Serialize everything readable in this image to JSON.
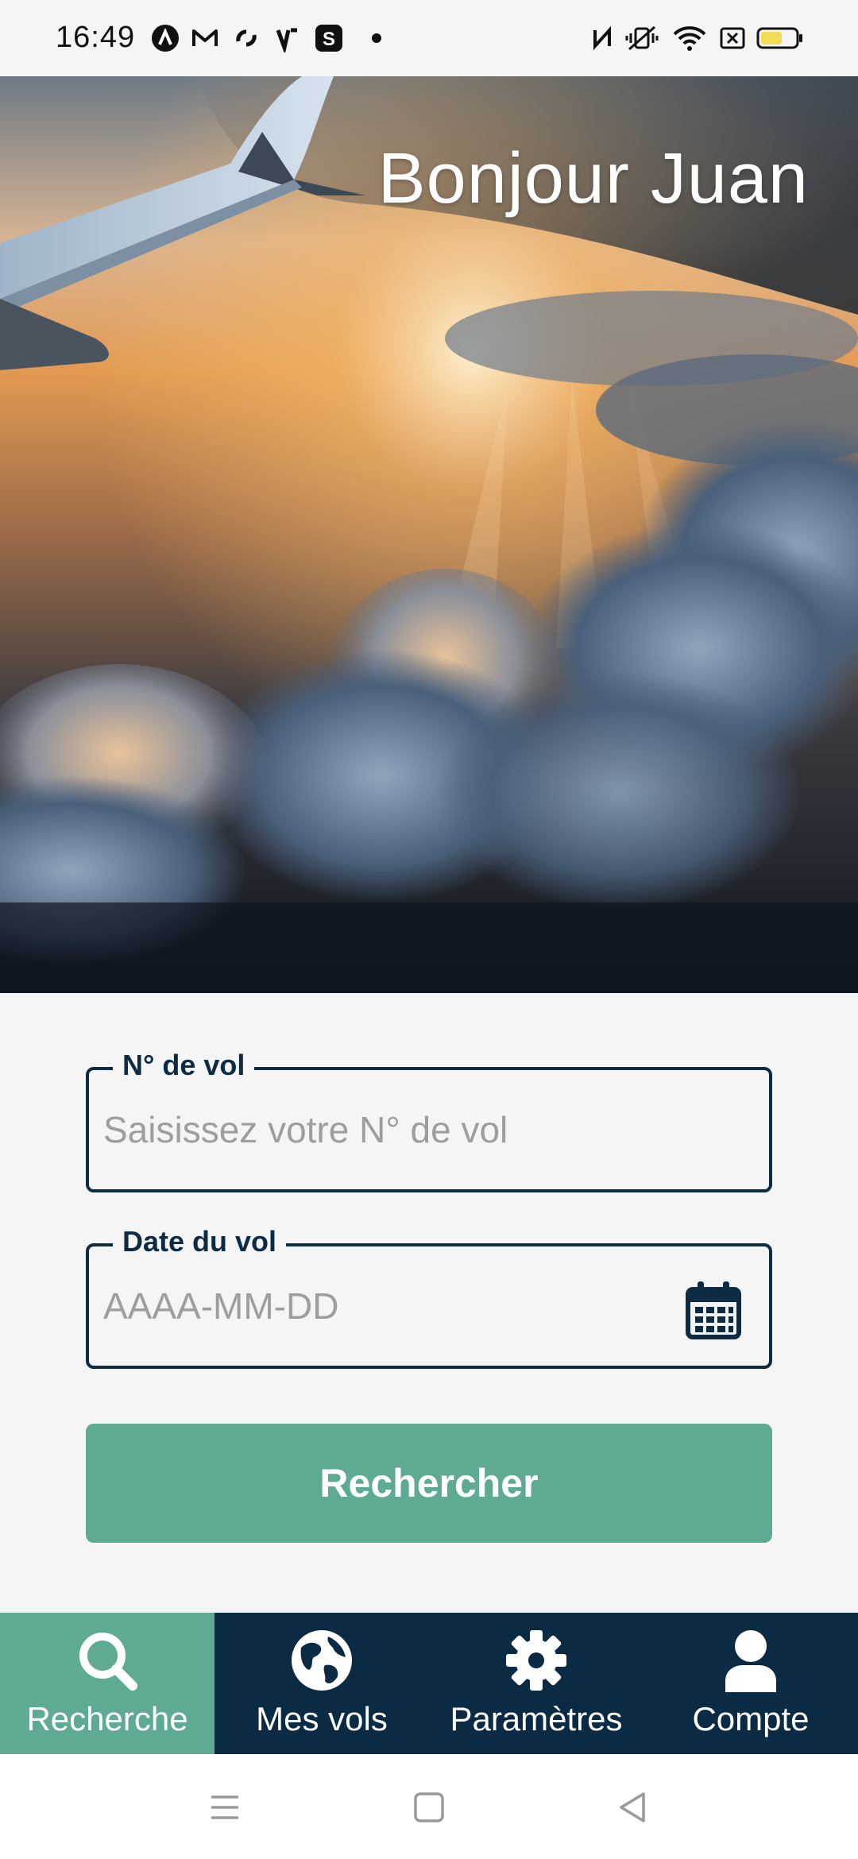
{
  "status_bar": {
    "time": "16:49",
    "left_icons": [
      "app-a-icon",
      "gmail-icon",
      "app-loop-icon",
      "app-v-icon",
      "app-s-icon",
      "dot-icon"
    ],
    "right_icons": [
      "nfc-icon",
      "vibrate-icon",
      "wifi-icon",
      "sim-icon",
      "battery-icon"
    ]
  },
  "hero": {
    "greeting": "Bonjour Juan"
  },
  "form": {
    "flight_number": {
      "label": "N° de vol",
      "placeholder": "Saisissez votre N° de vol",
      "value": ""
    },
    "flight_date": {
      "label": "Date du vol",
      "placeholder": "AAAA-MM-DD",
      "value": "",
      "icon": "calendar-icon"
    },
    "search_button": "Rechercher"
  },
  "bottom_nav": {
    "items": [
      {
        "label": "Recherche",
        "icon": "search-icon",
        "active": true
      },
      {
        "label": "Mes vols",
        "icon": "globe-icon",
        "active": false
      },
      {
        "label": "Paramètres",
        "icon": "gear-icon",
        "active": false
      },
      {
        "label": "Compte",
        "icon": "user-icon",
        "active": false
      }
    ]
  },
  "colors": {
    "primary_dark": "#0b2a44",
    "accent_green": "#5faa92",
    "background": "#f5f5f5"
  }
}
